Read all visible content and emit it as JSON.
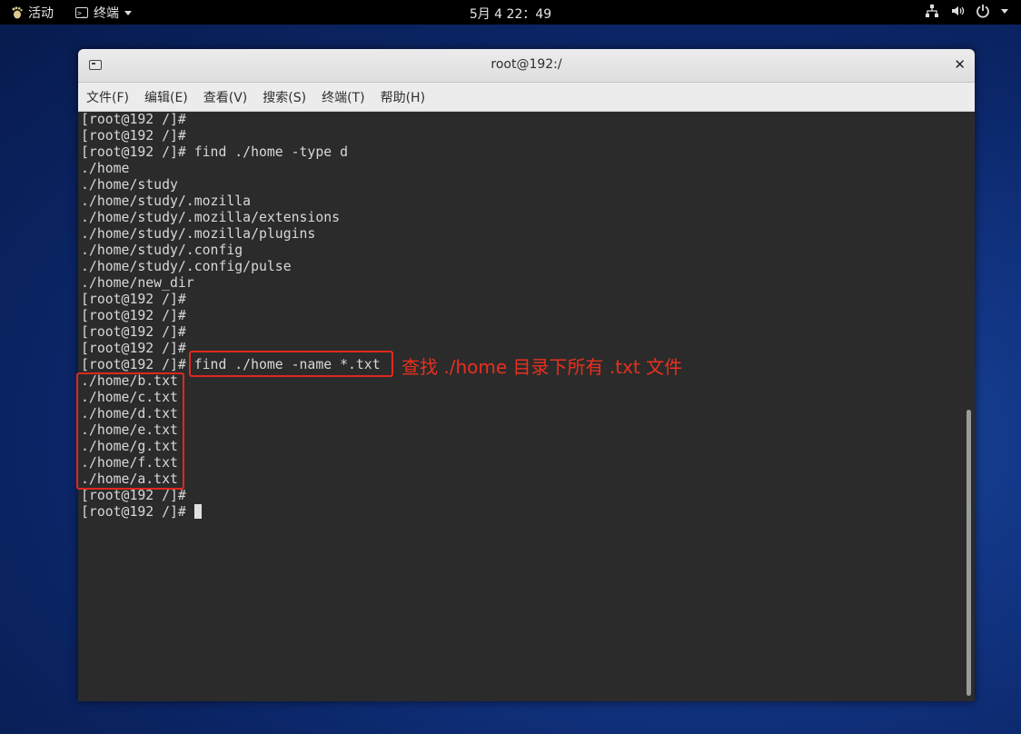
{
  "topbar": {
    "activities_label": "活动",
    "app_label": "终端",
    "clock": "5月 4  22：49",
    "tray_icons": [
      "network-icon",
      "volume-icon",
      "power-icon",
      "chevron-down-icon"
    ]
  },
  "window": {
    "title": "root@192:/",
    "close_glyph": "✕"
  },
  "menu": [
    {
      "label": "文件(F)"
    },
    {
      "label": "编辑(E)"
    },
    {
      "label": "查看(V)"
    },
    {
      "label": "搜索(S)"
    },
    {
      "label": "终端(T)"
    },
    {
      "label": "帮助(H)"
    }
  ],
  "terminal": {
    "lines": [
      "[root@192 /]#",
      "[root@192 /]#",
      "[root@192 /]# find ./home -type d",
      "./home",
      "./home/study",
      "./home/study/.mozilla",
      "./home/study/.mozilla/extensions",
      "./home/study/.mozilla/plugins",
      "./home/study/.config",
      "./home/study/.config/pulse",
      "./home/new_dir",
      "[root@192 /]#",
      "[root@192 /]#",
      "[root@192 /]#",
      "[root@192 /]#",
      "[root@192 /]# find ./home -name *.txt",
      "./home/b.txt",
      "./home/c.txt",
      "./home/d.txt",
      "./home/e.txt",
      "./home/g.txt",
      "./home/f.txt",
      "./home/a.txt",
      "[root@192 /]#"
    ],
    "prompt_line": "[root@192 /]# "
  },
  "annotation": {
    "text": "查找 ./home 目录下所有 .txt 文件",
    "color": "#e0281e"
  }
}
